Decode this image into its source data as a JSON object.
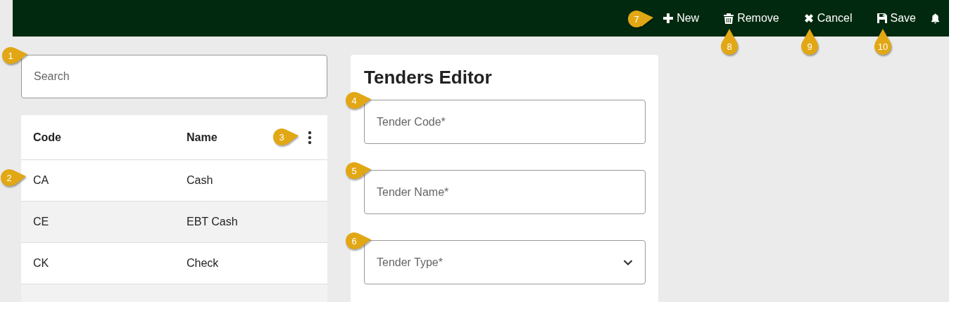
{
  "toolbar": {
    "buttons": [
      {
        "kind": "plus",
        "label": "New",
        "callout": {
          "number": "7",
          "kind": "right"
        }
      },
      {
        "kind": "trash",
        "label": "Remove",
        "callout": {
          "number": "8",
          "kind": "up"
        }
      },
      {
        "kind": "x",
        "label": "Cancel",
        "callout": {
          "number": "9",
          "kind": "up"
        }
      },
      {
        "kind": "save",
        "label": "Save",
        "callout": {
          "number": "10",
          "kind": "up"
        }
      }
    ]
  },
  "search": {
    "placeholder": "Search",
    "callout": {
      "number": "1",
      "kind": "right"
    }
  },
  "table": {
    "columns": [
      "Code",
      "Name"
    ],
    "menu_callout": {
      "number": "3",
      "kind": "right"
    },
    "rows": [
      {
        "code": "CA",
        "name": "Cash",
        "callout": {
          "number": "2",
          "kind": "right"
        }
      },
      {
        "code": "CE",
        "name": "EBT Cash"
      },
      {
        "code": "CK",
        "name": "Check"
      }
    ]
  },
  "editor": {
    "title": "Tenders Editor",
    "fields": [
      {
        "kind": "text",
        "placeholder": "Tender Code*",
        "callout": {
          "number": "4",
          "kind": "right"
        }
      },
      {
        "kind": "text",
        "placeholder": "Tender Name*",
        "callout": {
          "number": "5",
          "kind": "right"
        }
      },
      {
        "kind": "select",
        "placeholder": "Tender Type*",
        "callout": {
          "number": "6",
          "kind": "right"
        }
      }
    ]
  }
}
